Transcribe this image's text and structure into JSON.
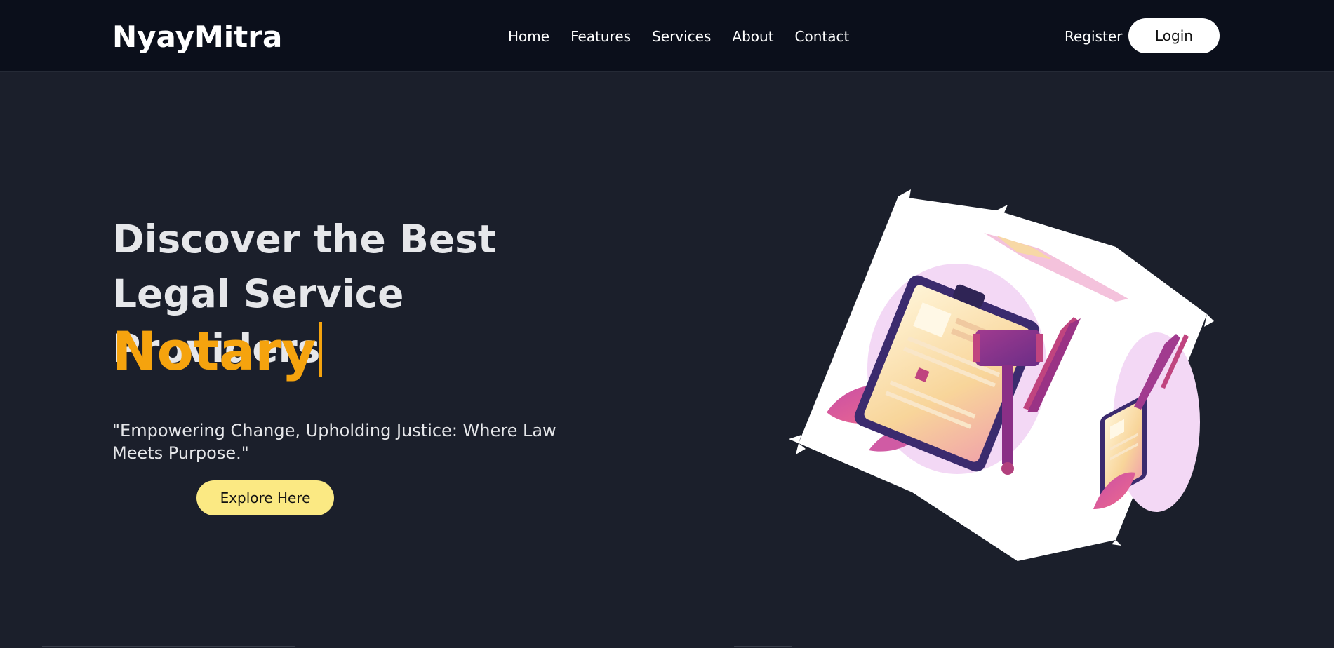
{
  "header": {
    "brand": "NyayMitra",
    "nav": [
      "Home",
      "Features",
      "Services",
      "About",
      "Contact"
    ],
    "register_label": "Register",
    "login_label": "Login"
  },
  "hero": {
    "title": "Discover the Best Legal Service Providers",
    "typed_word": "Notary",
    "tagline": "\"Empowering Change, Upholding Justice: Where Law Meets Purpose.\"",
    "explore_label": "Explore Here"
  },
  "colors": {
    "background": "#1b1f2b",
    "navbar": "#0b0f1b",
    "accent_orange": "#f5a30e",
    "button_yellow": "#fbe983"
  },
  "icons": {
    "hero_illustration": "legal-clipboard-gavel-cube"
  }
}
